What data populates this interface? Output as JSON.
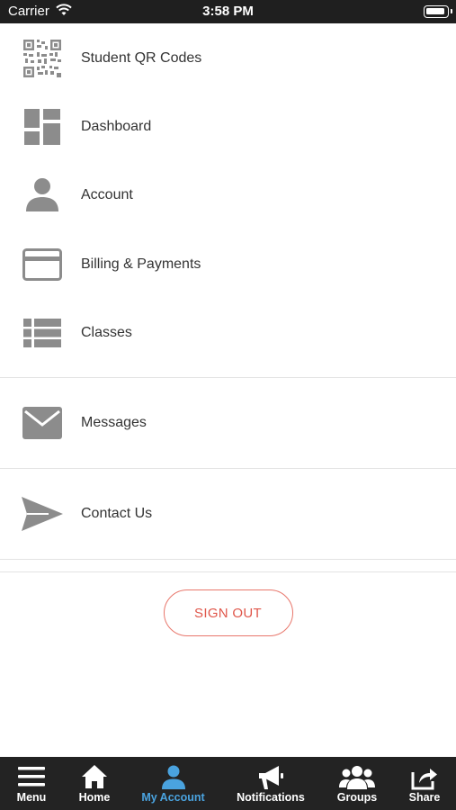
{
  "status_bar": {
    "carrier": "Carrier",
    "time": "3:58 PM"
  },
  "menu": {
    "items": [
      {
        "label": "Student QR Codes",
        "icon": "qr-code-icon"
      },
      {
        "label": "Dashboard",
        "icon": "dashboard-icon"
      },
      {
        "label": "Account",
        "icon": "person-icon"
      },
      {
        "label": "Billing & Payments",
        "icon": "credit-card-icon"
      },
      {
        "label": "Classes",
        "icon": "list-icon"
      },
      {
        "label": "Messages",
        "icon": "envelope-icon"
      },
      {
        "label": "Contact Us",
        "icon": "paper-plane-icon"
      }
    ]
  },
  "sign_out": {
    "label": "SIGN OUT",
    "color": "#e0574b"
  },
  "tab_bar": {
    "active": "My Account",
    "active_color": "#4aa3df",
    "tabs": [
      {
        "label": "Menu",
        "icon": "hamburger-icon"
      },
      {
        "label": "Home",
        "icon": "home-icon"
      },
      {
        "label": "My Account",
        "icon": "person-icon"
      },
      {
        "label": "Notifications",
        "icon": "megaphone-icon"
      },
      {
        "label": "Groups",
        "icon": "group-icon"
      },
      {
        "label": "Share",
        "icon": "share-icon"
      }
    ]
  }
}
